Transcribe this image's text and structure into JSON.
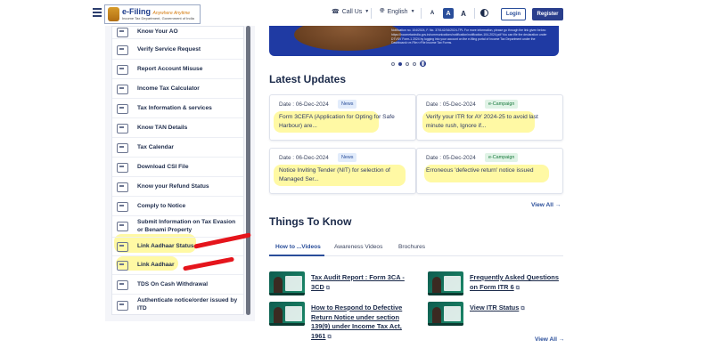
{
  "header": {
    "logo_title": "e-Filing",
    "logo_tagline": "Anywhere Anytime",
    "logo_subtitle": "Income Tax Department, Government of India",
    "call_us": "Call Us",
    "language": "English",
    "font_small": "A",
    "font_default": "A",
    "font_large": "A",
    "login": "Login",
    "register": "Register"
  },
  "sidebar": {
    "items": [
      {
        "label": "Know Your AO",
        "icon": "id-card-icon",
        "highlighted": false
      },
      {
        "label": "Verify Service Request",
        "icon": "verify-icon",
        "highlighted": false
      },
      {
        "label": "Report Account Misuse",
        "icon": "report-icon",
        "highlighted": false
      },
      {
        "label": "Income Tax Calculator",
        "icon": "calculator-icon",
        "highlighted": false
      },
      {
        "label": "Tax Information & services",
        "icon": "info-icon",
        "highlighted": false
      },
      {
        "label": "Know TAN Details",
        "icon": "document-icon",
        "highlighted": false
      },
      {
        "label": "Tax Calendar",
        "icon": "calendar-icon",
        "highlighted": false
      },
      {
        "label": "Download CSI File",
        "icon": "download-icon",
        "highlighted": false
      },
      {
        "label": "Know your Refund Status",
        "icon": "refund-icon",
        "highlighted": false
      },
      {
        "label": "Comply to Notice",
        "icon": "notice-icon",
        "highlighted": false
      },
      {
        "label": "Submit Information on Tax Evasion or Benami Property",
        "icon": "submit-icon",
        "highlighted": false
      },
      {
        "label": "Link Aadhaar Status",
        "icon": "link-icon",
        "highlighted": true
      },
      {
        "label": "Link Aadhaar",
        "icon": "link-icon",
        "highlighted": true
      },
      {
        "label": "TDS On Cash Withdrawal",
        "icon": "cash-icon",
        "highlighted": false
      },
      {
        "label": "Authenticate notice/order issued by ITD",
        "icon": "authenticate-icon",
        "highlighted": false
      }
    ]
  },
  "carousel": {
    "banner_text": "Notification no. 104/2024, F. No. 370142/16/2024-TPL\nFor more information, please go through the link given below:\nhttps://incometaxindia.gov.in/communications/notification/notification-104-2024.pdf\nYou can file the declaration under DTVSV Form-1 2024 by logging into your account on the e-filing portal of Income Tax Department under the Dashboard>>e-File>>File Income Tax Forms.",
    "slide_count": 4,
    "active_slide": 2
  },
  "latest_updates": {
    "title": "Latest Updates",
    "cards": [
      {
        "date": "Date : 06-Dec-2024",
        "badge": "News",
        "badge_type": "news",
        "text": "Form 3CEFA (Application for Opting for Safe Harbour) are..."
      },
      {
        "date": "Date : 05-Dec-2024",
        "badge": "e-Campaign",
        "badge_type": "camp",
        "text": "Verify your ITR for AY 2024-25 to avoid last minute rush, Ignore if..."
      },
      {
        "date": "Date : 06-Dec-2024",
        "badge": "News",
        "badge_type": "news",
        "text": "Notice Inviting Tender (NIT) for selection of Managed Ser..."
      },
      {
        "date": "Date : 05-Dec-2024",
        "badge": "e-Campaign",
        "badge_type": "camp",
        "text": "Erroneous 'defective return' notice issued"
      }
    ],
    "view_all": "View All"
  },
  "things_to_know": {
    "title": "Things To Know",
    "tabs": [
      "How to ...Videos",
      "Awareness Videos",
      "Brochures"
    ],
    "videos": [
      {
        "title": "Tax Audit Report : Form 3CA - 3CD"
      },
      {
        "title": "Frequently Asked Questions on Form ITR 6"
      },
      {
        "title": "How to Respond to Defective Return Notice under section 139(9) under Income Tax Act, 1961"
      },
      {
        "title": "View ITR Status"
      }
    ],
    "view_all": "View All"
  },
  "colors": {
    "primary": "#2a3e8c",
    "link": "#2a4e9a",
    "highlight": "#fff45a",
    "annotation_red": "#e5151c"
  }
}
